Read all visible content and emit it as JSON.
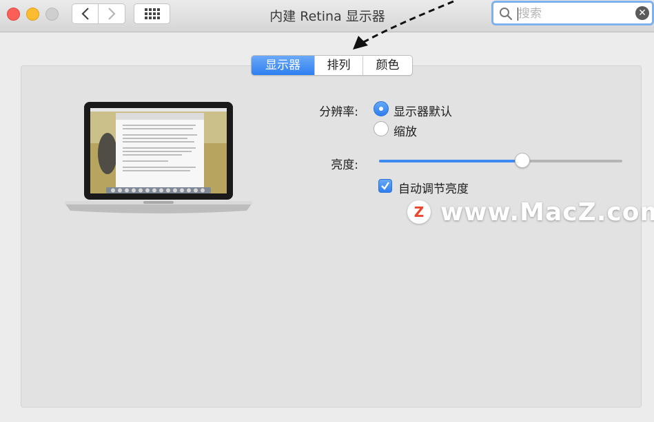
{
  "window": {
    "title": "内建 Retina 显示器"
  },
  "search": {
    "placeholder": "搜索",
    "value": ""
  },
  "tabs": [
    {
      "label": "显示器",
      "active": true
    },
    {
      "label": "排列",
      "active": false
    },
    {
      "label": "颜色",
      "active": false
    }
  ],
  "resolution": {
    "label": "分辨率:",
    "options": [
      {
        "label": "显示器默认",
        "selected": true
      },
      {
        "label": "缩放",
        "selected": false
      }
    ]
  },
  "brightness": {
    "label": "亮度:",
    "level_fraction": 0.59
  },
  "auto_brightness": {
    "label": "自动调节亮度",
    "checked": true
  },
  "watermark": {
    "logo_letter": "Z",
    "text": "www.MacZ.com"
  },
  "colors": {
    "accent": "#3e8af3",
    "close": "#fc5f57",
    "minimize": "#fdbc2f",
    "watermark_logo": "#e8472c"
  },
  "icons": [
    "back-chevron-icon",
    "forward-chevron-icon",
    "show-all-grid-icon",
    "search-icon",
    "clear-search-icon",
    "arrow-annotation-icon"
  ]
}
